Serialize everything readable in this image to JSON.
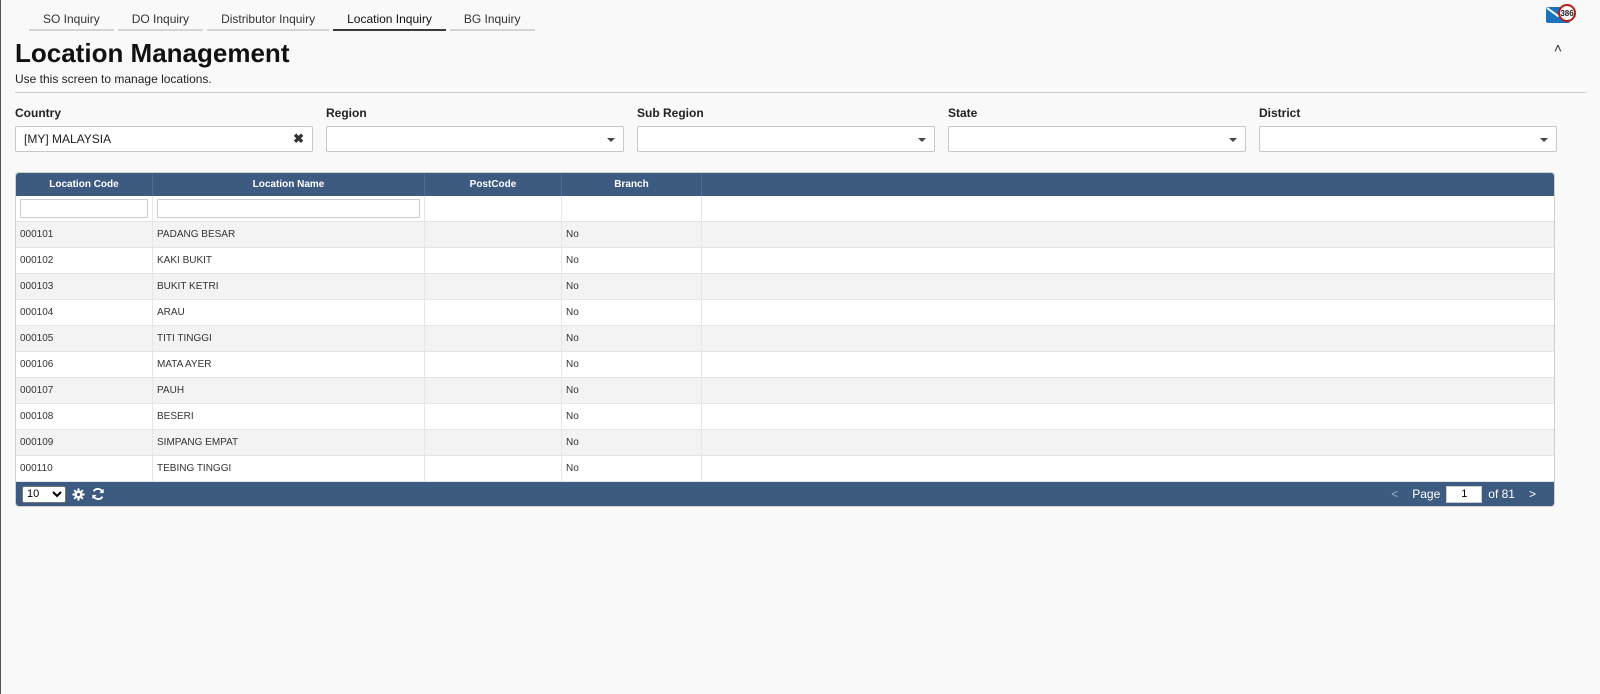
{
  "tabs": [
    {
      "label": "SO Inquiry",
      "active": false
    },
    {
      "label": "DO Inquiry",
      "active": false
    },
    {
      "label": "Distributor Inquiry",
      "active": false
    },
    {
      "label": "Location Inquiry",
      "active": true
    },
    {
      "label": "BG Inquiry",
      "active": false
    }
  ],
  "mail": {
    "badge": "386"
  },
  "header": {
    "title": "Location Management",
    "subtitle": "Use this screen to manage locations.",
    "collapse": "˄"
  },
  "filters": [
    {
      "label": "Country",
      "value": "[MY] MALAYSIA",
      "clearable": true
    },
    {
      "label": "Region",
      "value": "",
      "clearable": false
    },
    {
      "label": "Sub Region",
      "value": "",
      "clearable": false
    },
    {
      "label": "State",
      "value": "",
      "clearable": false
    },
    {
      "label": "District",
      "value": "",
      "clearable": false
    }
  ],
  "grid": {
    "columns": [
      "Location Code",
      "Location Name",
      "PostCode",
      "Branch"
    ],
    "filter_values": {
      "code": "",
      "name": ""
    },
    "rows": [
      {
        "code": "000101",
        "name": "PADANG BESAR",
        "postcode": "",
        "branch": "No"
      },
      {
        "code": "000102",
        "name": "KAKI BUKIT",
        "postcode": "",
        "branch": "No"
      },
      {
        "code": "000103",
        "name": "BUKIT KETRI",
        "postcode": "",
        "branch": "No"
      },
      {
        "code": "000104",
        "name": "ARAU",
        "postcode": "",
        "branch": "No"
      },
      {
        "code": "000105",
        "name": "TITI TINGGI",
        "postcode": "",
        "branch": "No"
      },
      {
        "code": "000106",
        "name": "MATA AYER",
        "postcode": "",
        "branch": "No"
      },
      {
        "code": "000107",
        "name": "PAUH",
        "postcode": "",
        "branch": "No"
      },
      {
        "code": "000108",
        "name": "BESERI",
        "postcode": "",
        "branch": "No"
      },
      {
        "code": "000109",
        "name": "SIMPANG EMPAT",
        "postcode": "",
        "branch": "No"
      },
      {
        "code": "000110",
        "name": "TEBING TINGGI",
        "postcode": "",
        "branch": "No"
      }
    ],
    "footer": {
      "page_size": "10",
      "page_size_options": [
        "10"
      ],
      "prev": "<",
      "next": ">",
      "page_label": "Page",
      "page": "1",
      "of_label": "of 81"
    }
  },
  "colors": {
    "header_bg": "#3d5a80",
    "badge_ring": "#b71c1c",
    "mail_icon": "#1e73be"
  }
}
